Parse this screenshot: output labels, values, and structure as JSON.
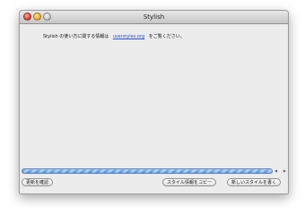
{
  "window": {
    "title": "Stylish"
  },
  "info": {
    "prefix": "Stylish の使い方に関する情報は",
    "link_text": "userstyles.org",
    "suffix": "をご覧ください。"
  },
  "progress": {
    "fraction": 1.0
  },
  "buttons": {
    "history": "更新を確認",
    "copy_info": "スタイル情報をコピー",
    "new_style": "新しいスタイルを書く"
  },
  "icons": {
    "close": "close-button-icon",
    "minimize": "minimize-button-icon",
    "zoom": "zoom-button-icon",
    "scroll_left": "arrow-left-icon",
    "scroll_right": "arrow-right-icon"
  }
}
